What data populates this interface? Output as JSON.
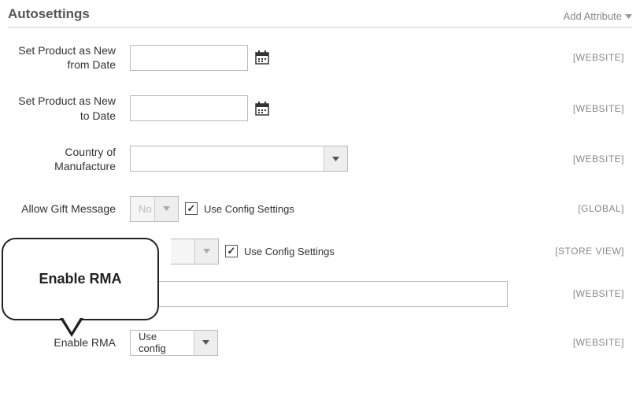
{
  "section": {
    "title": "Autosettings",
    "add_attribute": "Add Attribute"
  },
  "scopes": {
    "website": "[WEBSITE]",
    "global": "[GLOBAL]",
    "store_view": "[STORE VIEW]"
  },
  "fields": {
    "new_from": {
      "label": "Set Product as New from Date",
      "value": ""
    },
    "new_to": {
      "label": "Set Product as New to Date",
      "value": ""
    },
    "country": {
      "label": "Country of Manufacture",
      "value": ""
    },
    "gift": {
      "label": "Allow Gift Message",
      "value": "No",
      "use_config_label": "Use Config Settings"
    },
    "hidden_select": {
      "value": "",
      "use_config_label": "Use Config Settings"
    },
    "wide_text": {
      "value": ""
    },
    "rma": {
      "label": "Enable RMA",
      "value": "Use config"
    }
  },
  "tooltip": {
    "text": "Enable RMA"
  }
}
